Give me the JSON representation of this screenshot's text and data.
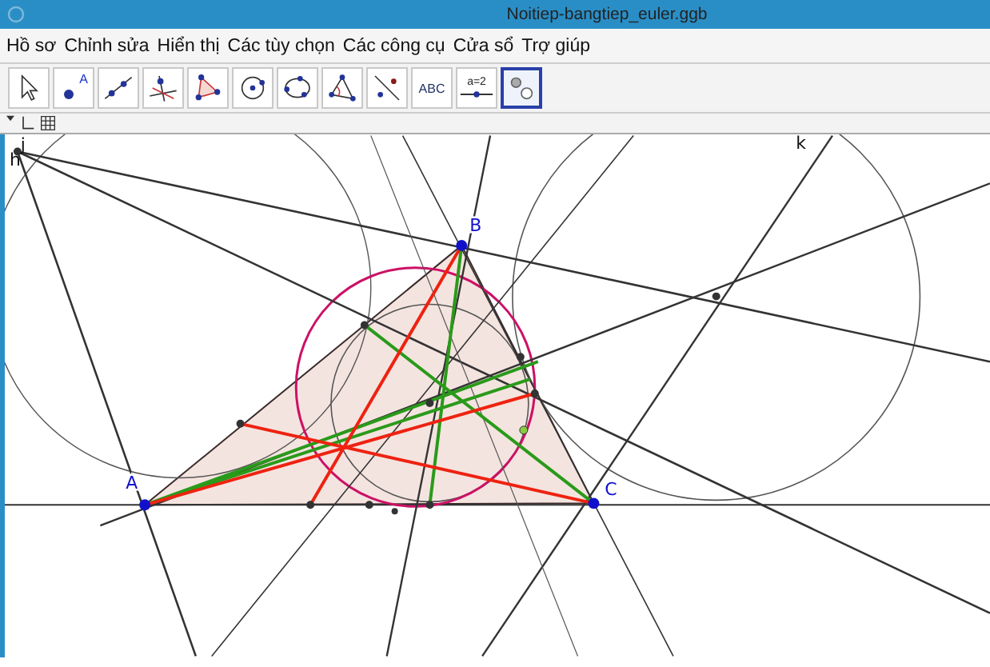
{
  "window": {
    "title": "Noitiep-bangtiep_euler.ggb"
  },
  "menu": [
    "Hồ sơ",
    "Chỉnh sửa",
    "Hiển thị",
    "Các tùy chọn",
    "Các công cụ",
    "Cửa sổ",
    "Trợ giúp"
  ],
  "tools": [
    {
      "kind": "move",
      "selected": false
    },
    {
      "kind": "point",
      "label": "A",
      "selected": false
    },
    {
      "kind": "line",
      "selected": false
    },
    {
      "kind": "perpendicular",
      "selected": false
    },
    {
      "kind": "polygon",
      "selected": false
    },
    {
      "kind": "circle",
      "selected": false
    },
    {
      "kind": "conic",
      "selected": false
    },
    {
      "kind": "angle",
      "selected": false
    },
    {
      "kind": "reflect",
      "selected": false
    },
    {
      "kind": "text",
      "label": "ABC",
      "selected": false
    },
    {
      "kind": "slider",
      "label": "a=2",
      "selected": false
    },
    {
      "kind": "checkbox",
      "selected": true
    }
  ],
  "labels": [
    {
      "text": "j",
      "kind": "line"
    },
    {
      "text": "h",
      "kind": "line"
    },
    {
      "text": "k",
      "kind": "line"
    },
    {
      "text": "B",
      "kind": "point"
    },
    {
      "text": "A",
      "kind": "point"
    },
    {
      "text": "C",
      "kind": "point"
    }
  ]
}
